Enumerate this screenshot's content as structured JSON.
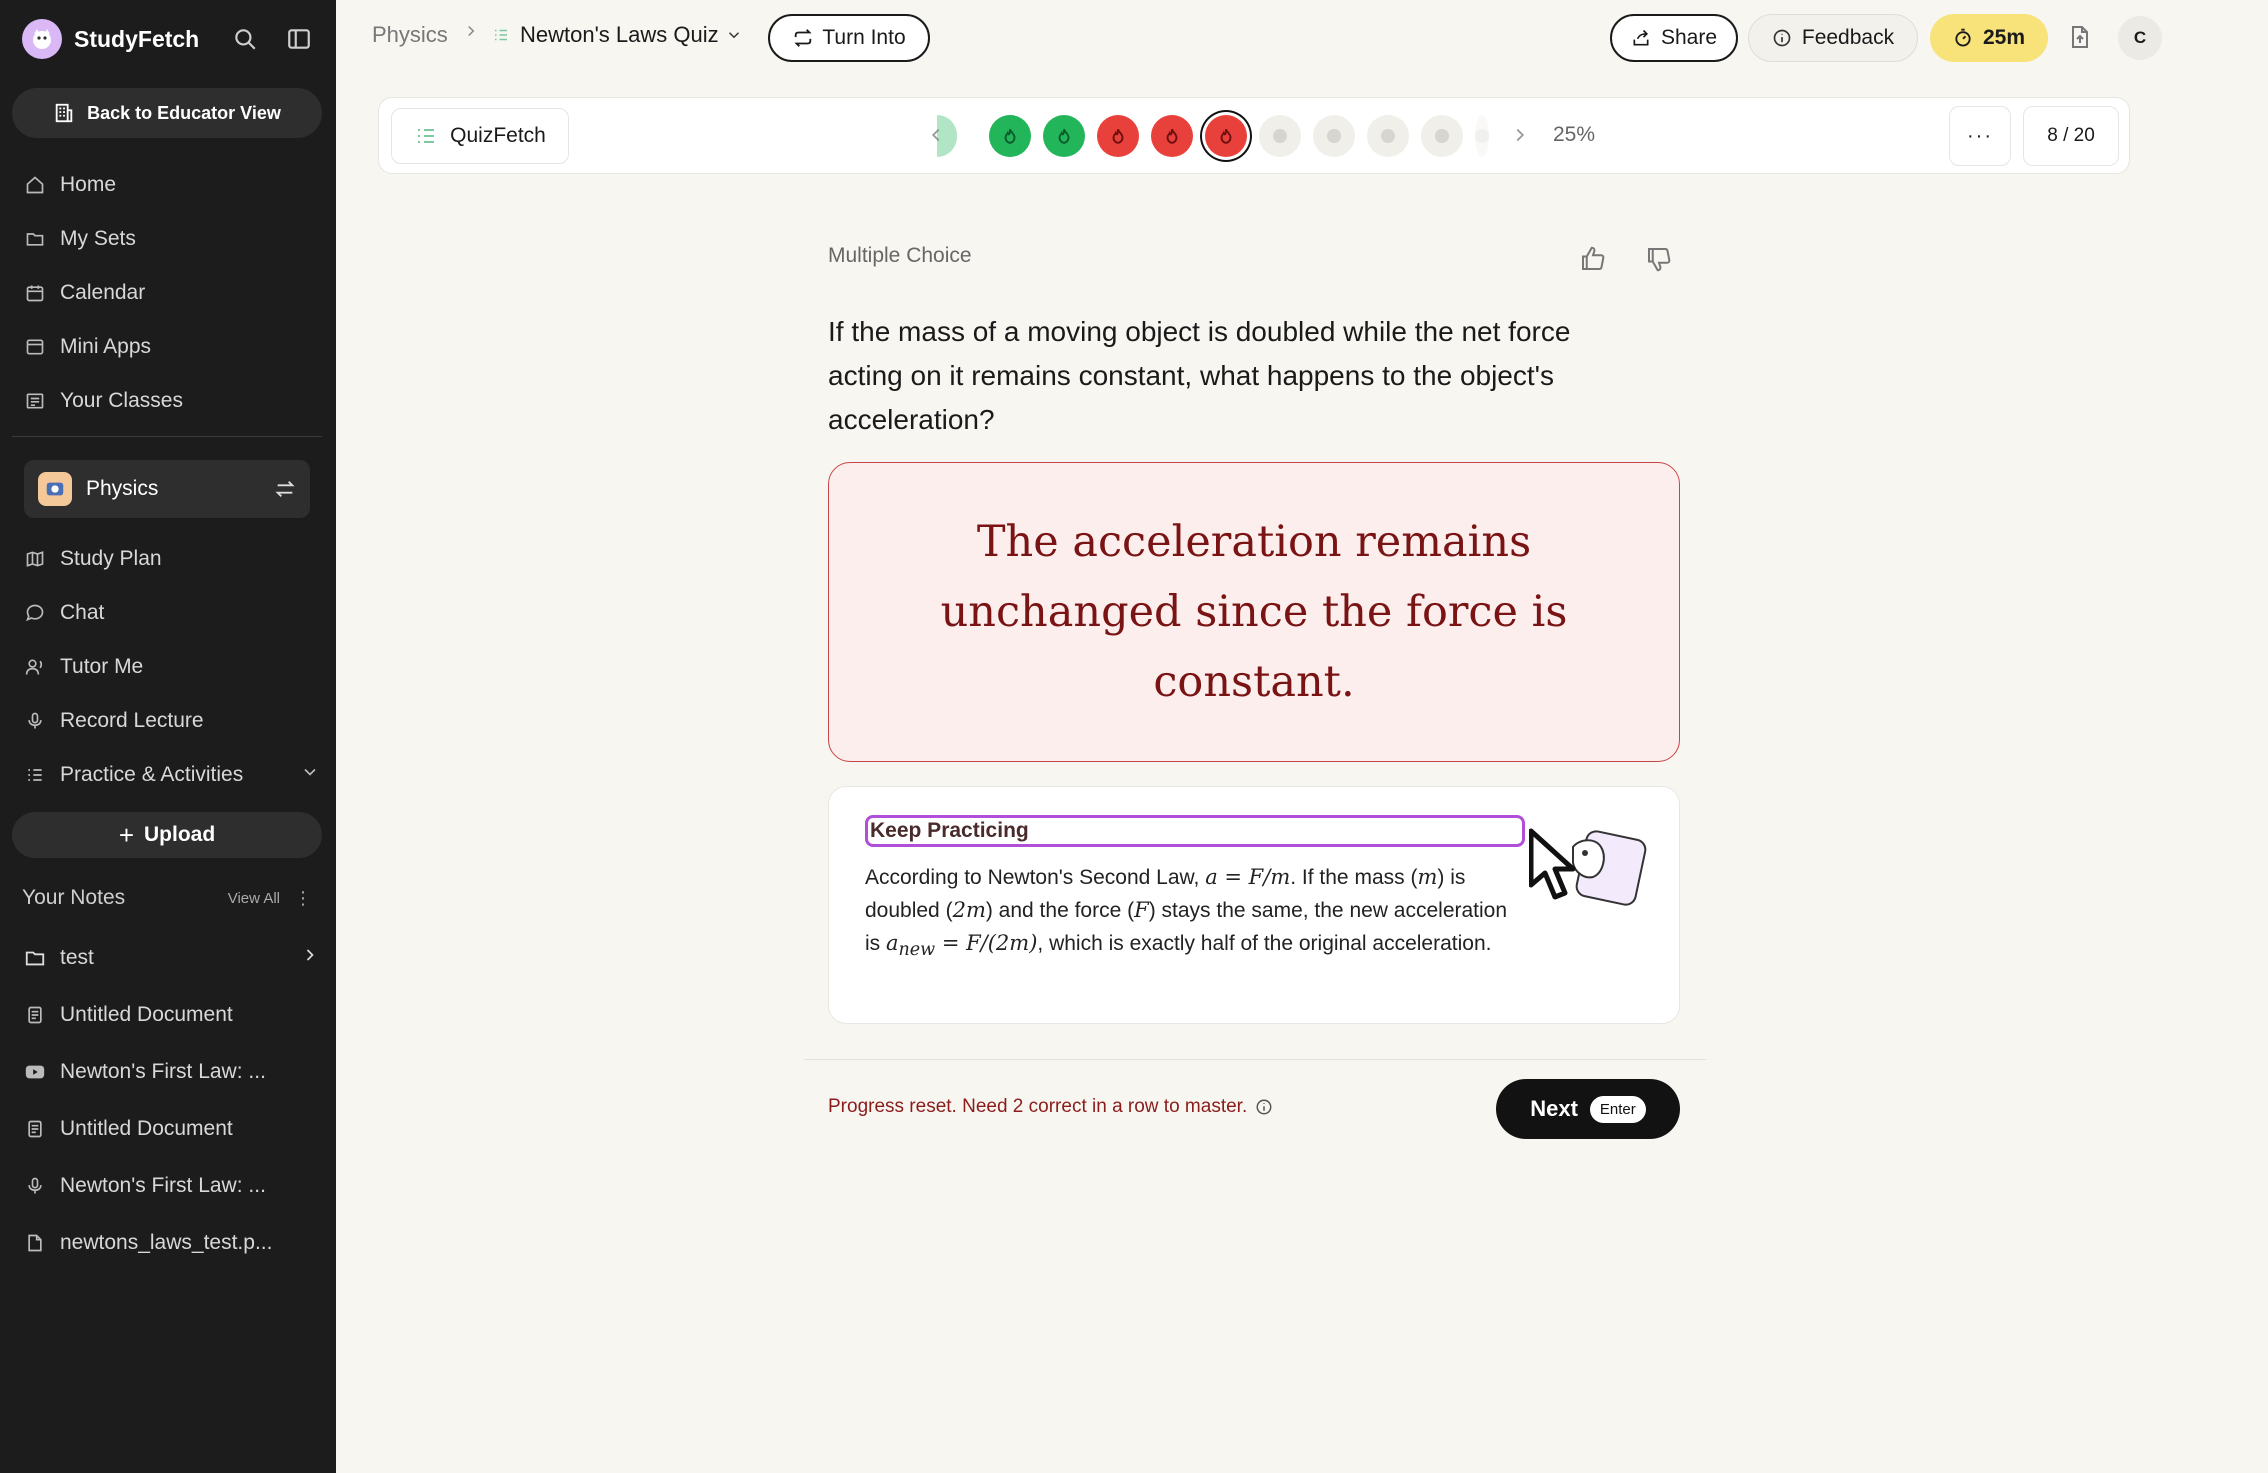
{
  "sidebar": {
    "brand": "StudyFetch",
    "back_label": "Back to Educator View",
    "nav": [
      {
        "label": "Home",
        "icon": "home-icon"
      },
      {
        "label": "My Sets",
        "icon": "folder-icon"
      },
      {
        "label": "Calendar",
        "icon": "calendar-icon"
      },
      {
        "label": "Mini Apps",
        "icon": "app-window-icon"
      },
      {
        "label": "Your Classes",
        "icon": "classes-icon"
      }
    ],
    "class_name": "Physics",
    "class_nav": [
      {
        "label": "Study Plan",
        "icon": "map-icon"
      },
      {
        "label": "Chat",
        "icon": "chat-bubble-icon"
      },
      {
        "label": "Tutor Me",
        "icon": "tutor-icon"
      },
      {
        "label": "Record Lecture",
        "icon": "microphone-icon"
      },
      {
        "label": "Practice & Activities",
        "icon": "list-icon"
      }
    ],
    "upload_label": "Upload",
    "notes_title": "Your Notes",
    "view_all": "View All",
    "notes": [
      {
        "label": "test",
        "icon": "folder-icon"
      },
      {
        "label": "Untitled Document",
        "icon": "document-icon"
      },
      {
        "label": "Newton's First Law: ...",
        "icon": "youtube-icon"
      },
      {
        "label": "Untitled Document",
        "icon": "document-icon"
      },
      {
        "label": "Newton's First Law: ...",
        "icon": "microphone-icon"
      },
      {
        "label": "newtons_laws_test.p...",
        "icon": "pdf-icon"
      }
    ]
  },
  "topbar": {
    "breadcrumb_root": "Physics",
    "breadcrumb_current": "Newton's Laws Quiz",
    "turn_into": "Turn Into",
    "share": "Share",
    "feedback": "Feedback",
    "timer": "25m",
    "avatar_initial": "C"
  },
  "quizbar": {
    "label": "QuizFetch",
    "progress": "25%",
    "count": "8 / 20",
    "more": "···",
    "dots": [
      "correct",
      "correct",
      "wrong",
      "wrong",
      "current",
      "empty",
      "empty",
      "empty",
      "empty"
    ]
  },
  "question": {
    "type": "Multiple Choice",
    "text": "If the mass of a moving object is doubled while the net force acting on it remains constant, what happens to the object's acceleration?",
    "selected_answer": "The acceleration remains unchanged since the force is constant."
  },
  "feedback": {
    "title": "Keep Practicing",
    "body_1": "According to Newton's Second Law, ",
    "formula_1": "a = F/m",
    "body_2": ". If the mass (",
    "formula_m": "m",
    "body_3": ") is doubled (",
    "formula_2m": "2m",
    "body_4": ") and the force (",
    "formula_F": "F",
    "body_5": ") stays the same, the new acceleration is ",
    "formula_new": "a",
    "formula_new_sub": "new",
    "formula_new_rest": " = F/(2m)",
    "body_6": ", which is exactly half of the original acceleration."
  },
  "footer": {
    "progress_message": "Progress reset. Need 2 correct in a row to master.",
    "next_label": "Next",
    "next_key": "Enter"
  },
  "colors": {
    "correct": "#22b55a",
    "wrong": "#e8403a",
    "timer_bg": "#f8e27a",
    "answer_border": "#c94545",
    "highlight": "#b24fd8"
  }
}
